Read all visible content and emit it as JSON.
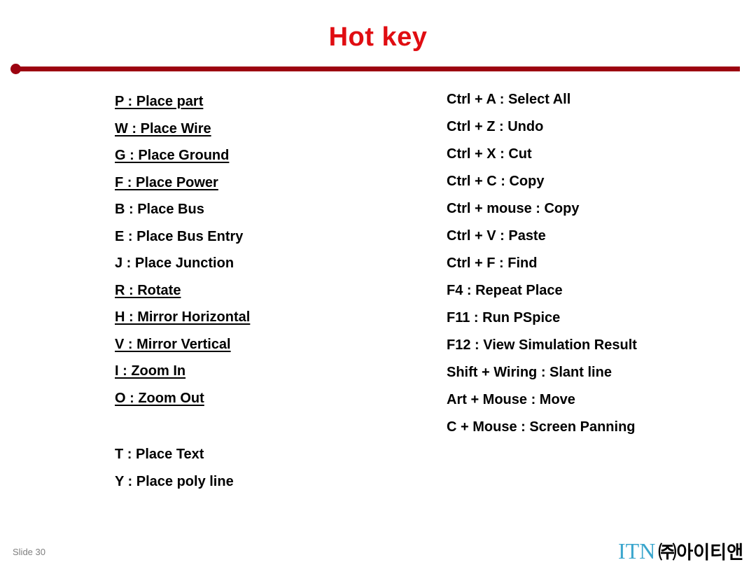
{
  "slide": {
    "title": "Hot key",
    "title_color": "#e00d12",
    "divider_color": "#9c0310",
    "slide_number": "Slide 30"
  },
  "left_column": {
    "items": [
      {
        "text": "P : Place part",
        "underlined": true
      },
      {
        "text": "W : Place Wire",
        "underlined": true
      },
      {
        "text": "G : Place Ground",
        "underlined": true
      },
      {
        "text": "F : Place Power",
        "underlined": true
      },
      {
        "text": "B : Place Bus",
        "underlined": false
      },
      {
        "text": "E : Place Bus Entry",
        "underlined": false
      },
      {
        "text": "J : Place Junction",
        "underlined": false
      },
      {
        "text": "R : Rotate",
        "underlined": true
      },
      {
        "text": "H : Mirror Horizontal",
        "underlined": true
      },
      {
        "text": "V : Mirror Vertical",
        "underlined": true
      },
      {
        "text": "I : Zoom In",
        "underlined": true
      },
      {
        "text": "O : Zoom Out",
        "underlined": true
      }
    ]
  },
  "left_column_secondary": {
    "items": [
      {
        "text": "T : Place Text",
        "underlined": false
      },
      {
        "text": "Y : Place poly line",
        "underlined": false
      }
    ]
  },
  "right_column": {
    "items": [
      {
        "text": "Ctrl + A : Select All",
        "underlined": false
      },
      {
        "text": "Ctrl + Z : Undo",
        "underlined": false
      },
      {
        "text": "Ctrl + X : Cut",
        "underlined": false
      },
      {
        "text": "Ctrl + C : Copy",
        "underlined": false
      },
      {
        "text": "Ctrl + mouse : Copy",
        "underlined": false
      },
      {
        "text": "Ctrl + V : Paste",
        "underlined": false
      },
      {
        "text": "Ctrl + F : Find",
        "underlined": false
      },
      {
        "text": "F4 : Repeat Place",
        "underlined": false
      },
      {
        "text": "F11 : Run PSpice",
        "underlined": false
      },
      {
        "text": "F12 : View Simulation Result",
        "underlined": false
      },
      {
        "text": "Shift + Wiring : Slant line",
        "underlined": false
      },
      {
        "text": "Art + Mouse : Move",
        "underlined": false
      },
      {
        "text": "C + Mouse : Screen Panning",
        "underlined": false
      }
    ]
  },
  "footer": {
    "logo_mark": "ITN",
    "logo_text": "㈜아이티앤",
    "logo_mark_color": "#3aa6cd"
  }
}
